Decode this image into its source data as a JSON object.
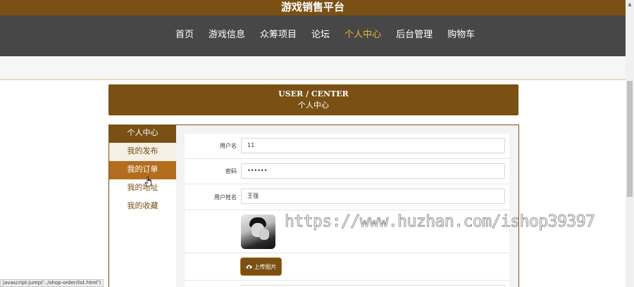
{
  "site": {
    "title": "游戏销售平台"
  },
  "nav": {
    "items": [
      {
        "label": "首页",
        "active": false
      },
      {
        "label": "游戏信息",
        "active": false
      },
      {
        "label": "众筹项目",
        "active": false
      },
      {
        "label": "论坛",
        "active": false
      },
      {
        "label": "个人中心",
        "active": true
      },
      {
        "label": "后台管理",
        "active": false
      },
      {
        "label": "购物车",
        "active": false
      }
    ]
  },
  "header": {
    "en": "USER / CENTER",
    "cn": "个人中心"
  },
  "sidebar": {
    "title": "个人中心",
    "items": [
      {
        "label": "我的发布"
      },
      {
        "label": "我的订单"
      },
      {
        "label": "我的地址"
      },
      {
        "label": "我的收藏"
      }
    ]
  },
  "form": {
    "username": {
      "label": "用户名",
      "value": "11"
    },
    "password": {
      "label": "密码",
      "value": "••••••"
    },
    "realname": {
      "label": "用户姓名",
      "value": "王强"
    },
    "upload_label": "上传图片"
  },
  "watermark": "https://www.huzhan.com/ishop39397",
  "status_bar": "javascript:jump('../shop-order/list.html')",
  "colors": {
    "brand": "#7a5014",
    "active_nav": "#f0b531",
    "nav_bg": "#474747",
    "sidebar_active": "#b26d1e"
  }
}
